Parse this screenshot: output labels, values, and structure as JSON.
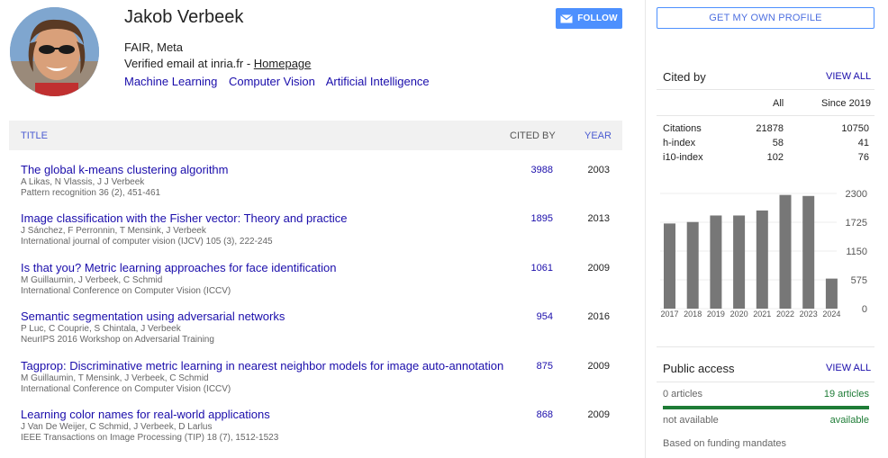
{
  "profile": {
    "name": "Jakob Verbeek",
    "affiliation": "FAIR, Meta",
    "email_text": "Verified email at inria.fr - ",
    "homepage_label": "Homepage",
    "interests": [
      "Machine Learning",
      "Computer Vision",
      "Artificial Intelligence"
    ],
    "follow_label": "FOLLOW",
    "own_profile_label": "GET MY OWN PROFILE"
  },
  "table": {
    "col_title": "TITLE",
    "col_cited": "CITED BY",
    "col_year": "YEAR",
    "rows": [
      {
        "title": "The global k-means clustering algorithm",
        "authors": "A Likas, N Vlassis, J J Verbeek",
        "venue": "Pattern recognition 36 (2), 451-461",
        "cited": "3988",
        "year": "2003"
      },
      {
        "title": "Image classification with the Fisher vector: Theory and practice",
        "authors": "J Sánchez, F Perronnin, T Mensink, J Verbeek",
        "venue": "International journal of computer vision (IJCV) 105 (3), 222-245",
        "cited": "1895",
        "year": "2013"
      },
      {
        "title": "Is that you? Metric learning approaches for face identification",
        "authors": "M Guillaumin, J Verbeek, C Schmid",
        "venue": "International Conference on Computer Vision (ICCV)",
        "cited": "1061",
        "year": "2009"
      },
      {
        "title": "Semantic segmentation using adversarial networks",
        "authors": "P Luc, C Couprie, S Chintala, J Verbeek",
        "venue": "NeurIPS 2016 Workshop on Adversarial Training",
        "cited": "954",
        "year": "2016"
      },
      {
        "title": "Tagprop: Discriminative metric learning in nearest neighbor models for image auto-annotation",
        "authors": "M Guillaumin, T Mensink, J Verbeek, C Schmid",
        "venue": "International Conference on Computer Vision (ICCV)",
        "cited": "875",
        "year": "2009"
      },
      {
        "title": "Learning color names for real-world applications",
        "authors": "J Van De Weijer, C Schmid, J Verbeek, D Larlus",
        "venue": "IEEE Transactions on Image Processing (TIP) 18 (7), 1512-1523",
        "cited": "868",
        "year": "2009"
      }
    ]
  },
  "cited_by": {
    "title": "Cited by",
    "view_all": "VIEW ALL",
    "col_all": "All",
    "col_since": "Since 2019",
    "stats": [
      {
        "label": "Citations",
        "all": "21878",
        "since": "10750"
      },
      {
        "label": "h-index",
        "all": "58",
        "since": "41"
      },
      {
        "label": "i10-index",
        "all": "102",
        "since": "76"
      }
    ]
  },
  "chart_data": {
    "type": "bar",
    "categories": [
      "2017",
      "2018",
      "2019",
      "2020",
      "2021",
      "2022",
      "2023",
      "2024"
    ],
    "values": [
      1700,
      1730,
      1860,
      1860,
      1960,
      2270,
      2250,
      600
    ],
    "ylim": [
      0,
      2300
    ],
    "yticks": [
      "0",
      "575",
      "1150",
      "1725",
      "2300"
    ],
    "bar_color": "#777777"
  },
  "public_access": {
    "title": "Public access",
    "view_all": "VIEW ALL",
    "unavailable_count": "0 articles",
    "available_count": "19 articles",
    "unavailable_label": "not available",
    "available_label": "available",
    "note": "Based on funding mandates",
    "available_color": "#1e7c36"
  }
}
